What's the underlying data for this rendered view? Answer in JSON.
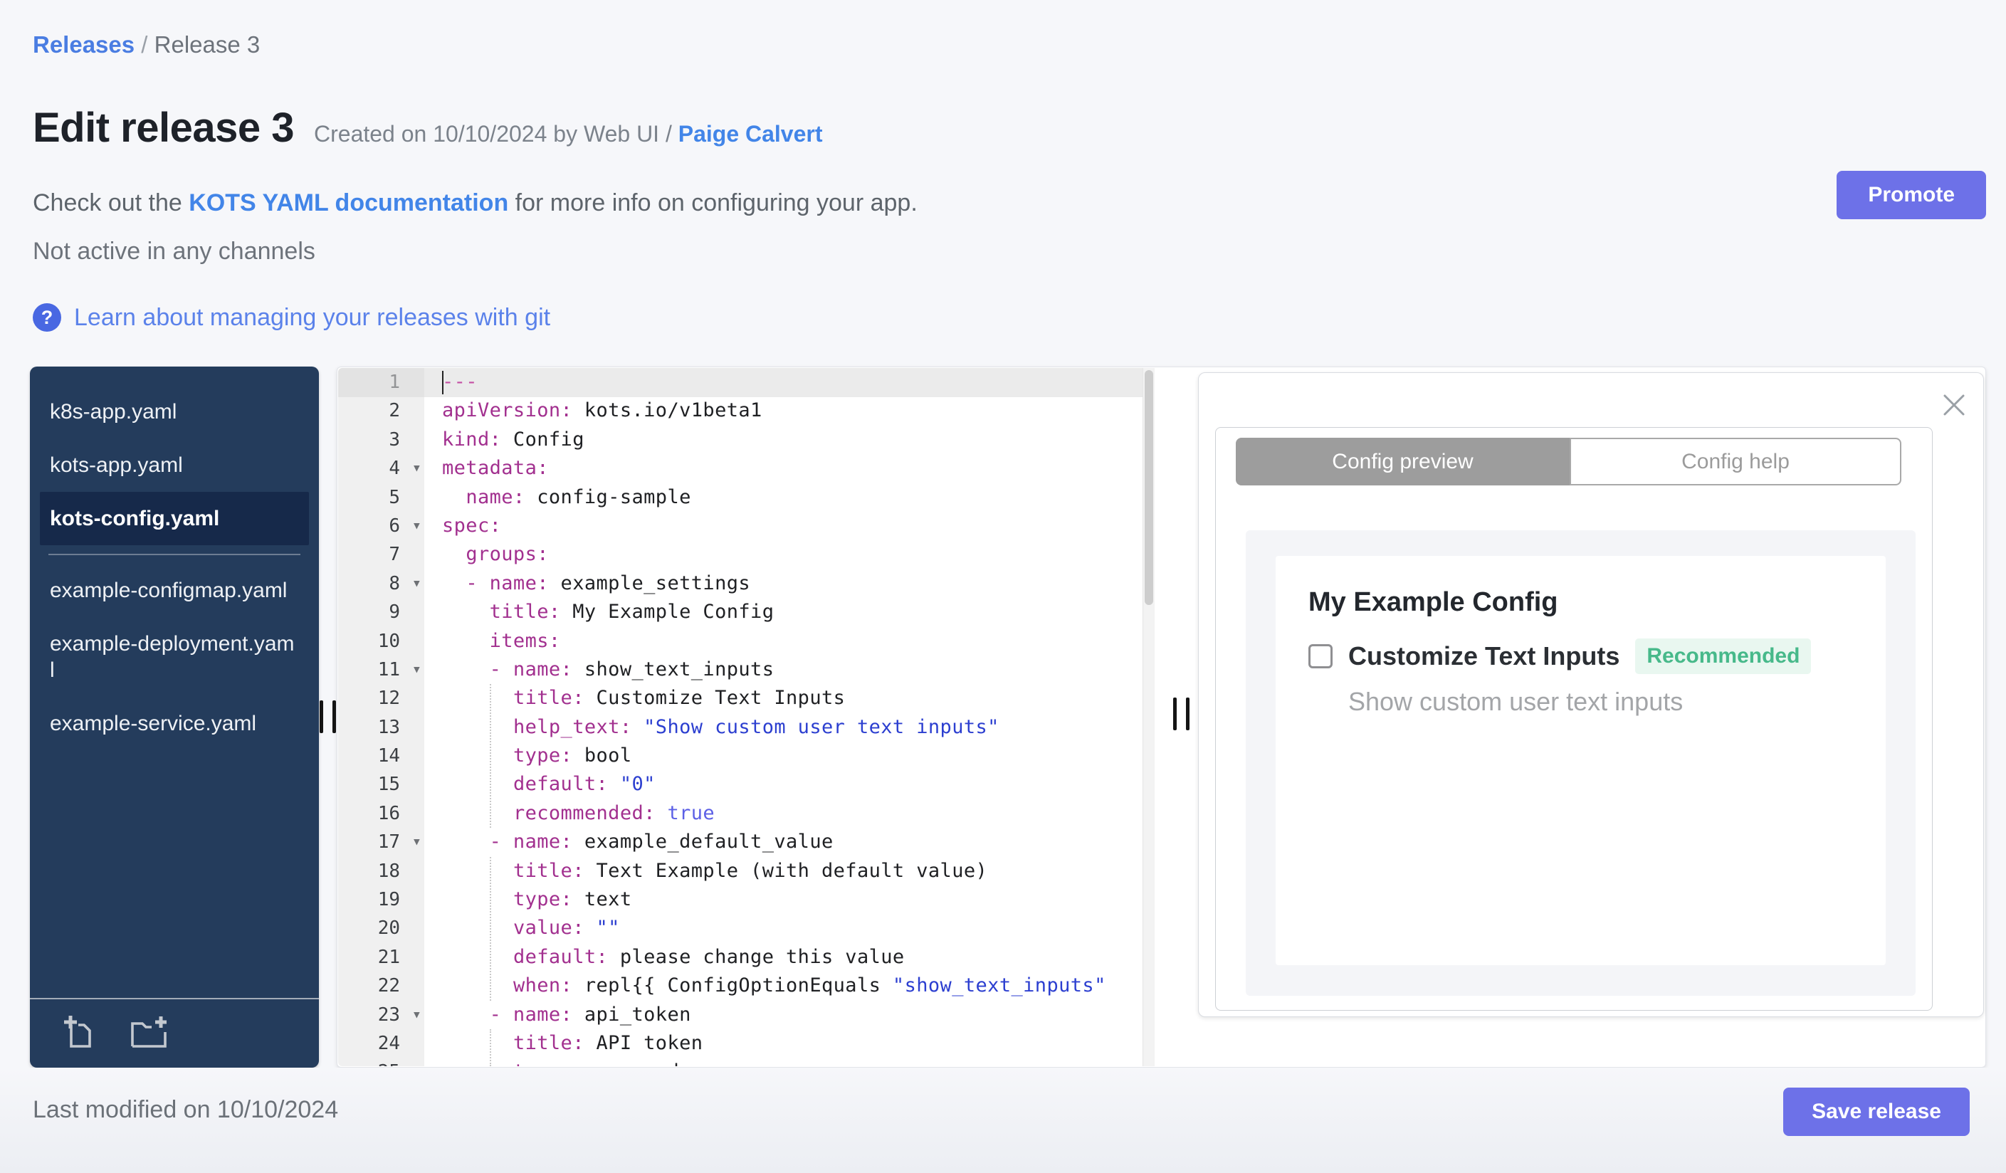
{
  "colors": {
    "accent_button": "#6d71e8",
    "link_blue": "#4285e8",
    "sidebar_navy": "#243c5c",
    "sidebar_selected": "#16294a",
    "badge_green_text": "#47b98a",
    "badge_green_bg": "#e9f7f0",
    "code_key": "#a2308f",
    "code_string": "#2c3fd0",
    "code_constant": "#5c60e6"
  },
  "breadcrumb": {
    "link": "Releases",
    "separator": " / ",
    "current": "Release 3"
  },
  "header": {
    "title": "Edit release 3",
    "created_prefix": "Created on 10/10/2024 by Web UI / ",
    "created_link": "Paige Calvert",
    "promote_label": "Promote",
    "doc_prefix": "Check out the ",
    "doc_link": "KOTS YAML documentation",
    "doc_suffix": " for more info on configuring your app.",
    "channel_status": "Not active in any channels",
    "help_icon_glyph": "?",
    "git_link": "Learn about managing your releases with git"
  },
  "sidebar": {
    "files_top": [
      {
        "name": "k8s-app.yaml",
        "selected": false
      },
      {
        "name": "kots-app.yaml",
        "selected": false
      },
      {
        "name": "kots-config.yaml",
        "selected": true
      }
    ],
    "files_bottom": [
      {
        "name": "example-configmap.yaml",
        "selected": false
      },
      {
        "name": "example-deployment.yaml",
        "selected": false
      },
      {
        "name": "example-service.yaml",
        "selected": false
      }
    ],
    "actions": [
      "new-file-icon",
      "new-folder-icon"
    ]
  },
  "editor": {
    "active_line": 1,
    "fold_lines": [
      4,
      6,
      8,
      11,
      17,
      23
    ],
    "fold_glyph": "▾",
    "lines": [
      [
        [
          "d",
          "---"
        ]
      ],
      [
        [
          "k",
          "apiVersion:"
        ],
        [
          "p",
          " kots.io/v1beta1"
        ]
      ],
      [
        [
          "k",
          "kind:"
        ],
        [
          "p",
          " Config"
        ]
      ],
      [
        [
          "k",
          "metadata:"
        ]
      ],
      [
        [
          "p",
          "  "
        ],
        [
          "k",
          "name:"
        ],
        [
          "p",
          " config-sample"
        ]
      ],
      [
        [
          "k",
          "spec:"
        ]
      ],
      [
        [
          "p",
          "  "
        ],
        [
          "k",
          "groups:"
        ]
      ],
      [
        [
          "p",
          "  "
        ],
        [
          "k",
          "- name:"
        ],
        [
          "p",
          " example_settings"
        ]
      ],
      [
        [
          "p",
          "    "
        ],
        [
          "k",
          "title:"
        ],
        [
          "p",
          " My Example Config"
        ]
      ],
      [
        [
          "p",
          "    "
        ],
        [
          "k",
          "items:"
        ]
      ],
      [
        [
          "p",
          "    "
        ],
        [
          "k",
          "- name:"
        ],
        [
          "p",
          " show_text_inputs"
        ]
      ],
      [
        [
          "p",
          "      "
        ],
        [
          "k",
          "title:"
        ],
        [
          "p",
          " Customize Text Inputs"
        ]
      ],
      [
        [
          "p",
          "      "
        ],
        [
          "k",
          "help_text:"
        ],
        [
          "p",
          " "
        ],
        [
          "s",
          "\"Show custom user text inputs\""
        ]
      ],
      [
        [
          "p",
          "      "
        ],
        [
          "k",
          "type:"
        ],
        [
          "p",
          " bool"
        ]
      ],
      [
        [
          "p",
          "      "
        ],
        [
          "k",
          "default:"
        ],
        [
          "p",
          " "
        ],
        [
          "s",
          "\"0\""
        ]
      ],
      [
        [
          "p",
          "      "
        ],
        [
          "k",
          "recommended:"
        ],
        [
          "p",
          " "
        ],
        [
          "c",
          "true"
        ]
      ],
      [
        [
          "p",
          "    "
        ],
        [
          "k",
          "- name:"
        ],
        [
          "p",
          " example_default_value"
        ]
      ],
      [
        [
          "p",
          "      "
        ],
        [
          "k",
          "title:"
        ],
        [
          "p",
          " Text Example (with default value)"
        ]
      ],
      [
        [
          "p",
          "      "
        ],
        [
          "k",
          "type:"
        ],
        [
          "p",
          " text"
        ]
      ],
      [
        [
          "p",
          "      "
        ],
        [
          "k",
          "value:"
        ],
        [
          "p",
          " "
        ],
        [
          "s",
          "\"\""
        ]
      ],
      [
        [
          "p",
          "      "
        ],
        [
          "k",
          "default:"
        ],
        [
          "p",
          " please change this value"
        ]
      ],
      [
        [
          "p",
          "      "
        ],
        [
          "k",
          "when:"
        ],
        [
          "p",
          " repl{{ ConfigOptionEquals "
        ],
        [
          "s",
          "\"show_text_inputs\""
        ]
      ],
      [
        [
          "p",
          "    "
        ],
        [
          "k",
          "- name:"
        ],
        [
          "p",
          " api_token"
        ]
      ],
      [
        [
          "p",
          "      "
        ],
        [
          "k",
          "title:"
        ],
        [
          "p",
          " API token"
        ]
      ],
      [
        [
          "p",
          "      "
        ],
        [
          "k",
          "type:"
        ],
        [
          "p",
          " password"
        ]
      ]
    ]
  },
  "panel": {
    "tabs": [
      {
        "label": "Config preview",
        "active": true
      },
      {
        "label": "Config help",
        "active": false
      }
    ],
    "preview": {
      "group_title": "My Example Config",
      "item_label": "Customize Text Inputs",
      "badge": "Recommended",
      "item_help": "Show custom user text inputs",
      "checkbox_checked": false
    }
  },
  "footer": {
    "last_modified": "Last modified on 10/10/2024",
    "save_label": "Save release"
  }
}
